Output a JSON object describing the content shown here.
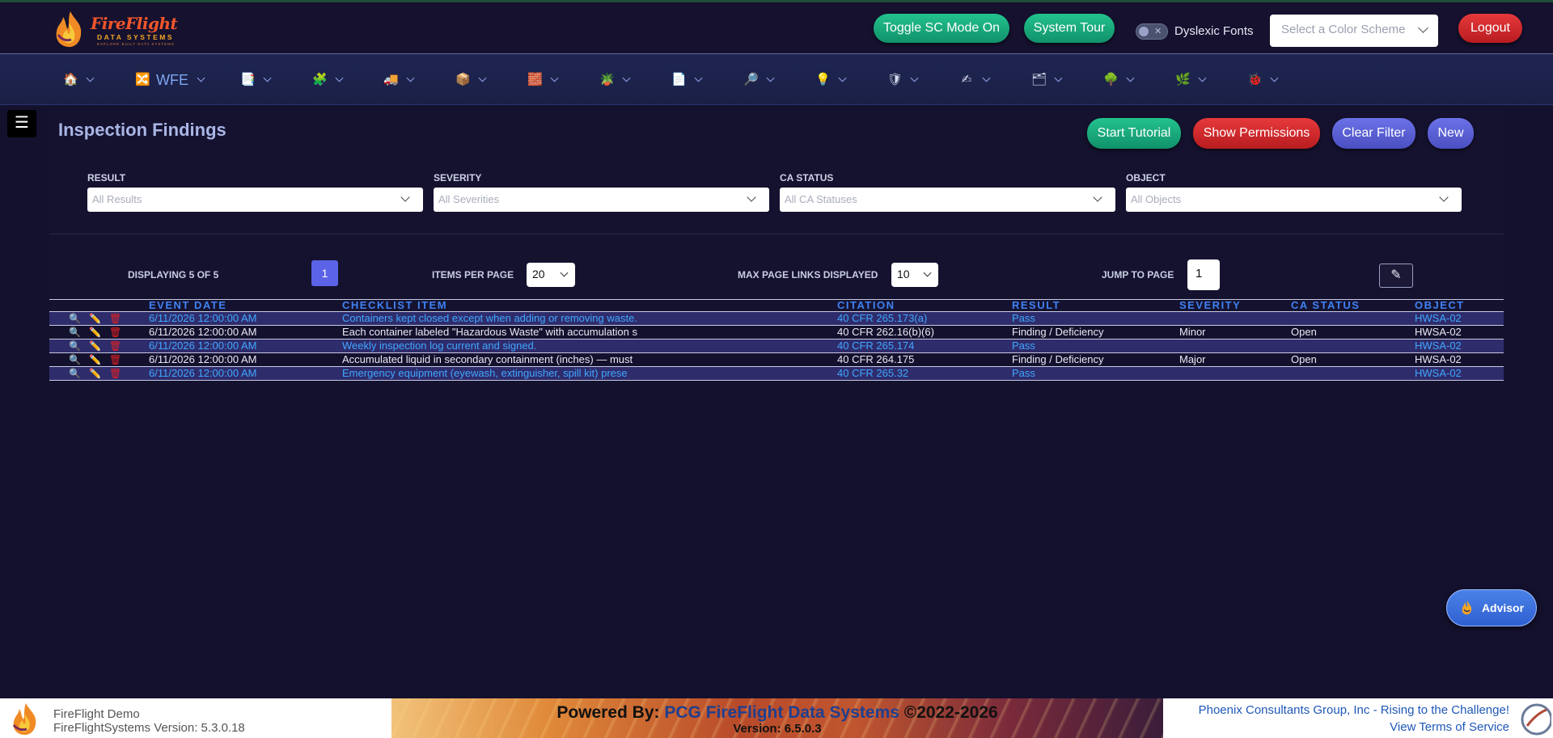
{
  "header": {
    "logo": {
      "name": "FireFlight",
      "sub": "DATA SYSTEMS",
      "tagline": "EXPLORE BUILT DATA SYSTEMS"
    },
    "buttons": {
      "toggle_sc": "Toggle SC Mode On",
      "system_tour": "System Tour",
      "logout": "Logout"
    },
    "dyslexic_label": "Dyslexic Fonts",
    "color_scheme_placeholder": "Select a Color Scheme"
  },
  "nav": {
    "items": [
      {
        "icon": "home-icon",
        "glyph": "🏠"
      },
      {
        "icon": "shuffle-icon",
        "glyph": "🔀",
        "label": "WFE"
      },
      {
        "icon": "document-icon",
        "glyph": "📑"
      },
      {
        "icon": "puzzle-icon",
        "glyph": "🧩"
      },
      {
        "icon": "truck-icon",
        "glyph": "🚚"
      },
      {
        "icon": "box-icon",
        "glyph": "📦"
      },
      {
        "icon": "brick-icon",
        "glyph": "🧱"
      },
      {
        "icon": "plant-icon",
        "glyph": "🪴"
      },
      {
        "icon": "page-icon",
        "glyph": "📄"
      },
      {
        "icon": "magnifier-icon",
        "glyph": "🔎"
      },
      {
        "icon": "lightbulb-icon",
        "glyph": "💡"
      },
      {
        "icon": "shield-icon",
        "glyph": "🛡"
      },
      {
        "icon": "hand-writing-icon",
        "glyph": "✍"
      },
      {
        "icon": "squares-icon",
        "glyph": "🗂"
      },
      {
        "icon": "tree-icon",
        "glyph": "🌳"
      },
      {
        "icon": "leaf-icon",
        "glyph": "🌿"
      },
      {
        "icon": "bug-icon",
        "glyph": "🐞"
      }
    ]
  },
  "page": {
    "title": "Inspection Findings",
    "actions": {
      "start_tutorial": "Start Tutorial",
      "show_permissions": "Show Permissions",
      "clear_filter": "Clear Filter",
      "new": "New"
    }
  },
  "filters": [
    {
      "label": "RESULT",
      "placeholder": "All Results"
    },
    {
      "label": "SEVERITY",
      "placeholder": "All Severities"
    },
    {
      "label": "CA STATUS",
      "placeholder": "All CA Statuses"
    },
    {
      "label": "OBJECT",
      "placeholder": "All Objects"
    }
  ],
  "pager": {
    "displaying": "DISPLAYING 5 OF 5",
    "current_page": "1",
    "items_per_page_label": "ITEMS PER PAGE",
    "items_per_page": "20",
    "max_links_label": "MAX PAGE LINKS DISPLAYED",
    "max_links": "10",
    "jump_label": "JUMP TO PAGE",
    "jump_value": "1"
  },
  "table": {
    "columns": [
      "EVENT DATE",
      "CHECKLIST ITEM",
      "CITATION",
      "RESULT",
      "SEVERITY",
      "CA STATUS",
      "OBJECT"
    ],
    "rows": [
      [
        "6/11/2026 12:00:00 AM",
        "Containers kept closed except when adding or removing waste.",
        "40 CFR 265.173(a)",
        "Pass",
        "",
        "",
        "HWSA-02"
      ],
      [
        "6/11/2026 12:00:00 AM",
        "Each container labeled \"Hazardous Waste\" with accumulation s",
        "40 CFR 262.16(b)(6)",
        "Finding / Deficiency",
        "Minor",
        "Open",
        "HWSA-02"
      ],
      [
        "6/11/2026 12:00:00 AM",
        "Weekly inspection log current and signed.",
        "40 CFR 265.174",
        "Pass",
        "",
        "",
        "HWSA-02"
      ],
      [
        "6/11/2026 12:00:00 AM",
        "Accumulated liquid in secondary containment (inches) — must",
        "40 CFR 264.175",
        "Finding / Deficiency",
        "Major",
        "Open",
        "HWSA-02"
      ],
      [
        "6/11/2026 12:00:00 AM",
        "Emergency equipment (eyewash, extinguisher, spill kit) prese",
        "40 CFR 265.32",
        "Pass",
        "",
        "",
        "HWSA-02"
      ]
    ]
  },
  "advisor_label": "Advisor",
  "footer": {
    "app_name": "FireFlight Demo",
    "app_version": "FireFlightSystems Version: 5.3.0.18",
    "powered_prefix": "Powered By: ",
    "powered_brand": "PCG FireFlight Data Systems",
    "powered_suffix": " ©2022-2026",
    "version": "Version: 6.5.0.3",
    "company": "Phoenix Consultants Group, Inc - Rising to the Challenge!",
    "terms": "View Terms of Service"
  },
  "colors": {
    "background": "#14112e",
    "accent_green": "#16a37a",
    "accent_red": "#d22a2d",
    "accent_blue": "#5b63e6",
    "link_blue": "#3fa7ff"
  }
}
